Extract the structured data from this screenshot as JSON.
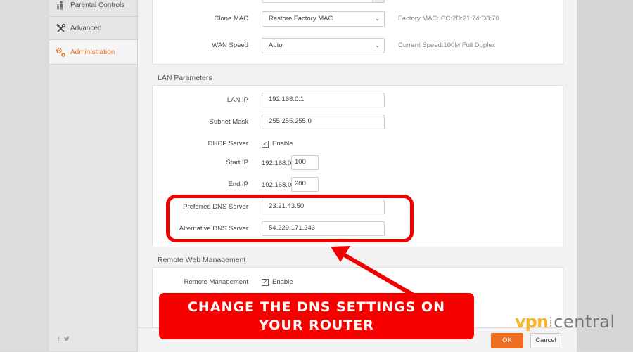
{
  "sidebar": {
    "items": [
      {
        "label": "Parental Controls",
        "icon": "parental-controls-icon",
        "active": false
      },
      {
        "label": "Advanced",
        "icon": "tools-icon",
        "active": false
      },
      {
        "label": "Administration",
        "icon": "gears-icon",
        "active": true
      }
    ],
    "social": {
      "facebook": "f",
      "twitter": "🐦"
    }
  },
  "wan": {
    "clone_mac": {
      "label": "Clone MAC",
      "value": "Restore Factory MAC",
      "hint": "Factory MAC: CC:2D:21:74:D8:70"
    },
    "wan_speed": {
      "label": "WAN Speed",
      "value": "Auto",
      "hint": "Current Speed:100M Full Duplex"
    }
  },
  "lan": {
    "title": "LAN Parameters",
    "lan_ip": {
      "label": "LAN IP",
      "value": "192.168.0.1"
    },
    "subnet_mask": {
      "label": "Subnet Mask",
      "value": "255.255.255.0"
    },
    "dhcp_server": {
      "label": "DHCP Server",
      "checkbox_label": "Enable",
      "checked": true
    },
    "start_ip": {
      "label": "Start IP",
      "prefix": "192.168.0.",
      "value": "100"
    },
    "end_ip": {
      "label": "End IP",
      "prefix": "192.168.0.",
      "value": "200"
    },
    "preferred_dns": {
      "label": "Preferred DNS Server",
      "value": "23.21.43.50"
    },
    "alternative_dns": {
      "label": "Alternative DNS Server",
      "value": "54.229.171.243"
    }
  },
  "remote": {
    "title": "Remote Web Management",
    "remote_management": {
      "label": "Remote Management",
      "checkbox_label": "Enable",
      "checked": true
    }
  },
  "footer": {
    "ok_label": "OK",
    "cancel_label": "Cancel"
  },
  "annotation": {
    "line1": "CHANGE THE DNS SETTINGS ON",
    "line2": "YOUR ROUTER",
    "color": "#f70000"
  },
  "watermark": {
    "part1": "vpn",
    "part2": "central"
  },
  "colors": {
    "accent": "#ed6d21",
    "active_sidebar": "#e8772e"
  }
}
